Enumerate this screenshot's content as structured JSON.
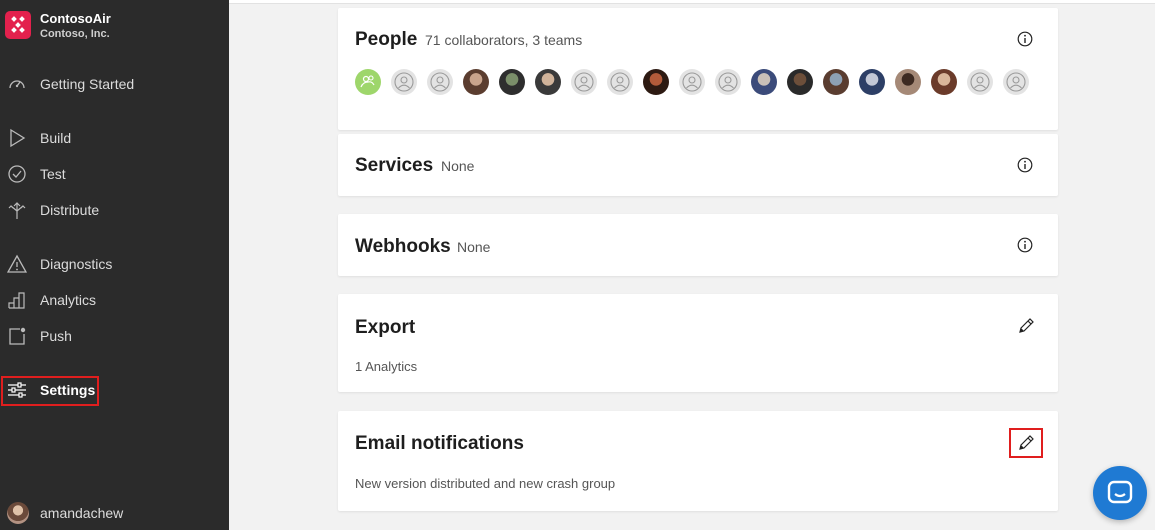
{
  "app": {
    "name": "ContosoAir",
    "org": "Contoso, Inc.",
    "brand_color": "#e3214d"
  },
  "sidebar": {
    "items": [
      {
        "label": "Getting Started",
        "icon": "speedometer-icon"
      },
      {
        "label": "Build",
        "icon": "play-triangle-icon"
      },
      {
        "label": "Test",
        "icon": "check-circle-icon"
      },
      {
        "label": "Distribute",
        "icon": "distribute-arrows-icon"
      },
      {
        "label": "Diagnostics",
        "icon": "warning-triangle-icon"
      },
      {
        "label": "Analytics",
        "icon": "bar-chart-icon"
      },
      {
        "label": "Push",
        "icon": "push-square-icon"
      },
      {
        "label": "Settings",
        "icon": "sliders-icon",
        "active": true
      }
    ],
    "user": {
      "name": "amandachew"
    }
  },
  "cards": {
    "people": {
      "title": "People",
      "subtitle": "71 collaborators, 3 teams",
      "avatars": [
        "group",
        "generic",
        "generic",
        "photo",
        "photo",
        "photo",
        "generic",
        "generic",
        "photo",
        "generic",
        "generic",
        "photo",
        "photo",
        "photo",
        "photo",
        "photo",
        "photo",
        "generic",
        "generic"
      ]
    },
    "services": {
      "title": "Services",
      "subtitle": "None"
    },
    "webhooks": {
      "title": "Webhooks",
      "subtitle": "None"
    },
    "export": {
      "title": "Export",
      "body": "1 Analytics"
    },
    "email": {
      "title": "Email notifications",
      "body": "New version distributed and new crash group"
    }
  },
  "colors": {
    "sidebar_bg": "#2b2b2b",
    "highlight": "#e01e1e",
    "chat_button": "#1f7ad3"
  }
}
